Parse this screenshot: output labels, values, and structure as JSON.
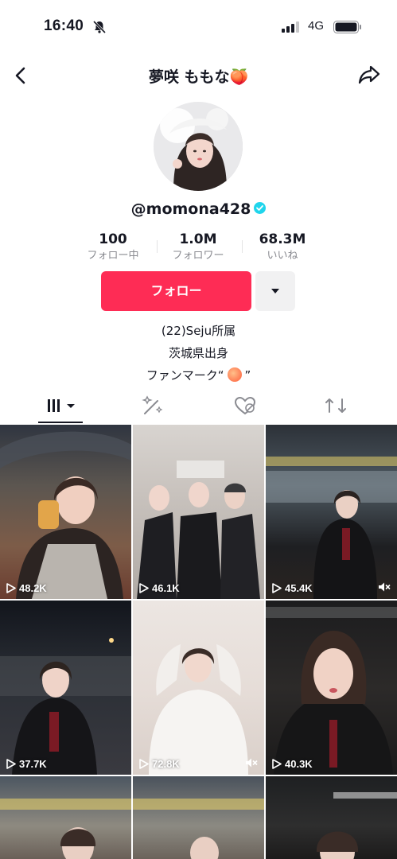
{
  "status_bar": {
    "time": "16:40",
    "network": "4G"
  },
  "header": {
    "title": "夢咲 ももな🍑"
  },
  "profile": {
    "handle": "@momona428",
    "stats": [
      {
        "value": "100",
        "label": "フォロー中"
      },
      {
        "value": "1.0M",
        "label": "フォロワー"
      },
      {
        "value": "68.3M",
        "label": "いいね"
      }
    ],
    "follow_label": "フォロー",
    "bio": [
      "(22)Seju所属",
      "茨城県出身"
    ],
    "fanmark_prefix": "ファンマーク“",
    "fanmark_suffix": "”"
  },
  "tabs": [
    "videos",
    "reposts",
    "liked",
    "shared"
  ],
  "colors": {
    "accent": "#fe2c55",
    "verified": "#20d5ec"
  },
  "videos": [
    {
      "views": "48.2K",
      "muted": false
    },
    {
      "views": "46.1K",
      "muted": false
    },
    {
      "views": "45.4K",
      "muted": true
    },
    {
      "views": "37.7K",
      "muted": false
    },
    {
      "views": "72.8K",
      "muted": true
    },
    {
      "views": "40.3K",
      "muted": false
    },
    {
      "views": "",
      "muted": false
    },
    {
      "views": "",
      "muted": false
    },
    {
      "views": "",
      "muted": false
    }
  ]
}
